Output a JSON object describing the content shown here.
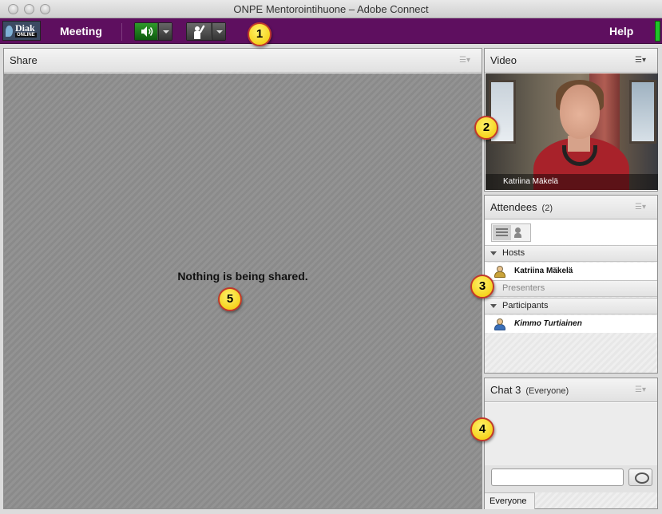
{
  "window": {
    "title": "ONPE Mentorointihuone – Adobe Connect"
  },
  "menubar": {
    "logo_top": "Diak",
    "logo_bottom": "ONLINE",
    "meeting_label": "Meeting",
    "help_label": "Help",
    "speaker_icon": "speaker-icon",
    "raise_hand_icon": "raise-hand-icon",
    "accent_color": "#5e0f5f"
  },
  "share": {
    "title": "Share",
    "message": "Nothing is being shared."
  },
  "video": {
    "title": "Video",
    "participant_name": "Katriina Mäkelä"
  },
  "attendees": {
    "title": "Attendees",
    "count": "(2)",
    "groups": {
      "hosts": {
        "label": "Hosts",
        "members": [
          "Katriina Mäkelä"
        ]
      },
      "presenters": {
        "label": "Presenters",
        "members": []
      },
      "participants": {
        "label": "Participants",
        "members": [
          "Kimmo Turtiainen"
        ]
      }
    }
  },
  "chat": {
    "title": "Chat 3",
    "scope": "(Everyone)",
    "input_value": "",
    "tab_label": "Everyone"
  },
  "callouts": [
    "1",
    "2",
    "3",
    "4",
    "5"
  ]
}
